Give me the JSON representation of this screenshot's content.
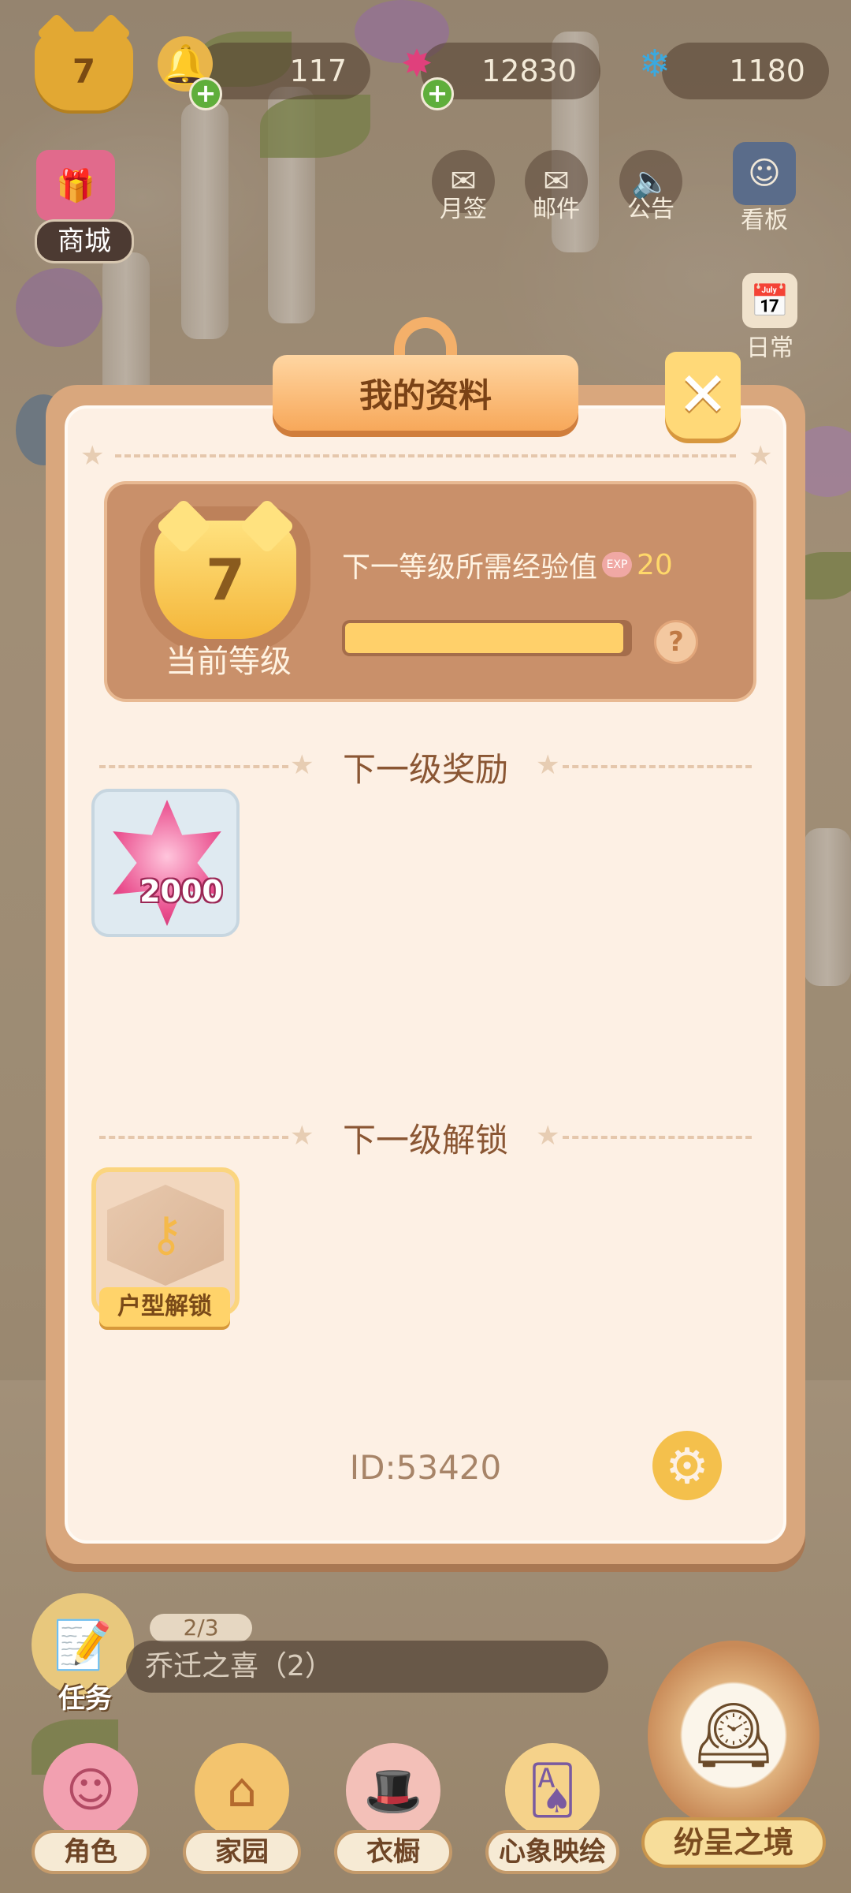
{
  "topbar": {
    "player_level": "7",
    "bell_count": "117",
    "pink_gem_count": "12830",
    "blue_gem_count": "1180"
  },
  "side": {
    "shop": "商城",
    "monthly_signin": "月签",
    "mail": "邮件",
    "announcement": "公告",
    "board": "看板",
    "daily": "日常"
  },
  "modal": {
    "title": "我的资料",
    "close_glyph": "✕",
    "current_level": "7",
    "current_level_label": "当前等级",
    "exp_needed_label": "下一等级所需经验值",
    "exp_chip": "EXP",
    "exp_needed_value": "20",
    "exp_progress": 0.98,
    "help_glyph": "?",
    "next_reward_title": "下一级奖励",
    "reward_count": "2000",
    "next_unlock_title": "下一级解锁",
    "unlock_label": "户型解锁",
    "id_text": "ID:53420"
  },
  "hud": {
    "task_label": "任务",
    "task_progress": "2/3",
    "task_name": "乔迁之喜（2）",
    "nav": [
      "角色",
      "家园",
      "衣橱",
      "心象映绘",
      "纷呈之境"
    ]
  },
  "colors": {
    "modal_frame": "#d9a77d",
    "modal_bg": "#fdf0e4",
    "level_card": "#c9906a",
    "accent_yellow": "#ffd06a"
  }
}
